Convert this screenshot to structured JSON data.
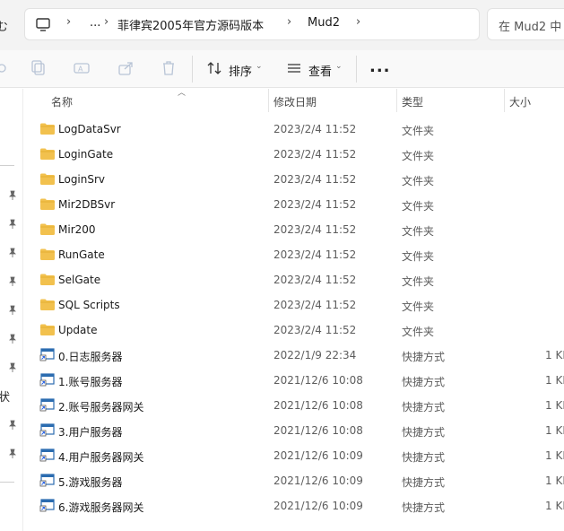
{
  "address_bar": {
    "left_char": "む",
    "crumbs": [
      "...",
      "菲律宾2005年官方源码版本",
      "Mud2"
    ],
    "search_placeholder": "在 Mud2 中"
  },
  "toolbar": {
    "sort_label": "排序",
    "view_label": "查看",
    "more_label": "..."
  },
  "nav_pane": {
    "partial_char": "状"
  },
  "columns": {
    "name": "名称",
    "date": "修改日期",
    "type": "类型",
    "size": "大小"
  },
  "files": [
    {
      "name": "LogDataSvr",
      "date": "2023/2/4 11:52",
      "type": "文件夹",
      "size": "",
      "icon": "folder-icon"
    },
    {
      "name": "LoginGate",
      "date": "2023/2/4 11:52",
      "type": "文件夹",
      "size": "",
      "icon": "folder-icon"
    },
    {
      "name": "LoginSrv",
      "date": "2023/2/4 11:52",
      "type": "文件夹",
      "size": "",
      "icon": "folder-icon"
    },
    {
      "name": "Mir2DBSvr",
      "date": "2023/2/4 11:52",
      "type": "文件夹",
      "size": "",
      "icon": "folder-icon"
    },
    {
      "name": "Mir200",
      "date": "2023/2/4 11:52",
      "type": "文件夹",
      "size": "",
      "icon": "folder-icon"
    },
    {
      "name": "RunGate",
      "date": "2023/2/4 11:52",
      "type": "文件夹",
      "size": "",
      "icon": "folder-icon"
    },
    {
      "name": "SelGate",
      "date": "2023/2/4 11:52",
      "type": "文件夹",
      "size": "",
      "icon": "folder-icon"
    },
    {
      "name": "SQL Scripts",
      "date": "2023/2/4 11:52",
      "type": "文件夹",
      "size": "",
      "icon": "folder-icon"
    },
    {
      "name": "Update",
      "date": "2023/2/4 11:52",
      "type": "文件夹",
      "size": "",
      "icon": "folder-icon"
    },
    {
      "name": "0.日志服务器",
      "date": "2022/1/9 22:34",
      "type": "快捷方式",
      "size": "1 KI",
      "icon": "shortcut-icon"
    },
    {
      "name": "1.账号服务器",
      "date": "2021/12/6 10:08",
      "type": "快捷方式",
      "size": "1 KI",
      "icon": "shortcut-icon"
    },
    {
      "name": "2.账号服务器网关",
      "date": "2021/12/6 10:08",
      "type": "快捷方式",
      "size": "1 KI",
      "icon": "shortcut-icon"
    },
    {
      "name": "3.用户服务器",
      "date": "2021/12/6 10:08",
      "type": "快捷方式",
      "size": "1 KI",
      "icon": "shortcut-icon"
    },
    {
      "name": "4.用户服务器网关",
      "date": "2021/12/6 10:09",
      "type": "快捷方式",
      "size": "1 KI",
      "icon": "shortcut-icon"
    },
    {
      "name": "5.游戏服务器",
      "date": "2021/12/6 10:09",
      "type": "快捷方式",
      "size": "1 KI",
      "icon": "shortcut-icon"
    },
    {
      "name": "6.游戏服务器网关",
      "date": "2021/12/6 10:09",
      "type": "快捷方式",
      "size": "1 KI",
      "icon": "shortcut-icon"
    }
  ],
  "colors": {
    "folder": "#f2c14e",
    "shortcut": "#2b6cb0"
  }
}
